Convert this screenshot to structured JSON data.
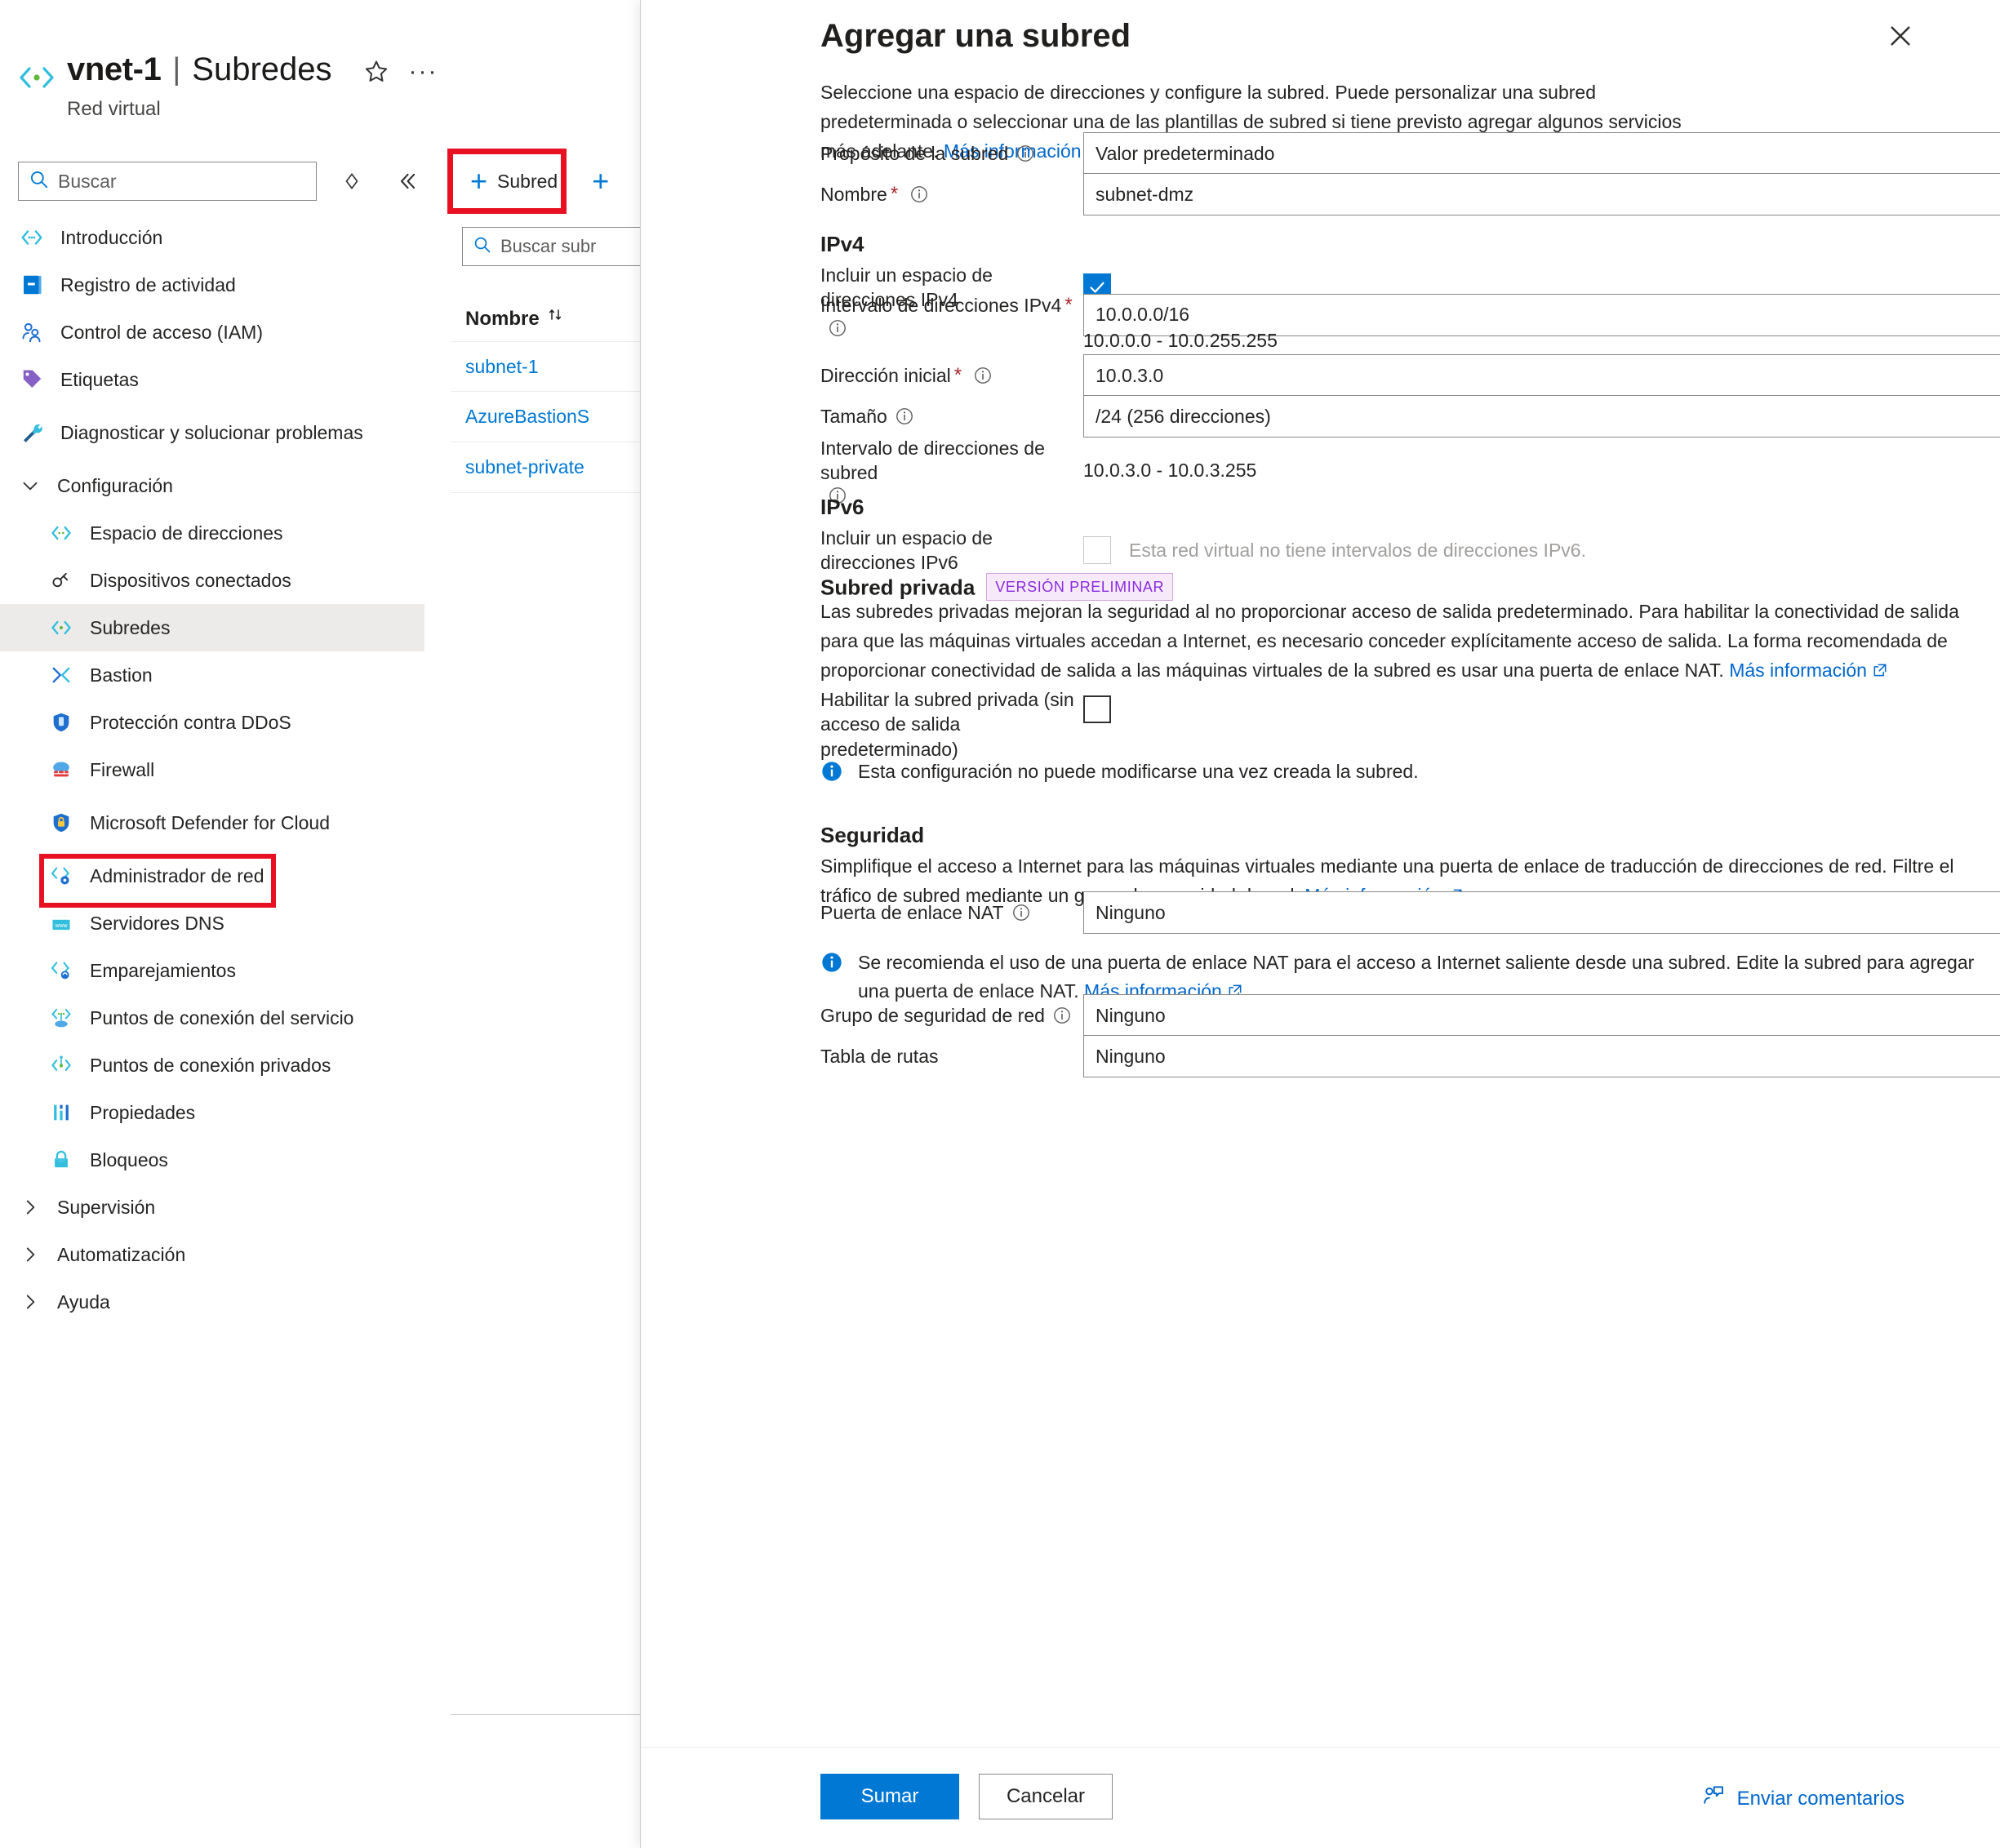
{
  "resource": {
    "name": "vnet-1",
    "separator": "|",
    "section": "Subredes",
    "type": "Red virtual",
    "icon": "vnet-icon"
  },
  "left_search": {
    "placeholder": "Buscar"
  },
  "sidebar": {
    "items": [
      {
        "label": "Introducción",
        "icon": "vnet-icon",
        "level": "top"
      },
      {
        "label": "Registro de actividad",
        "icon": "activity-log-icon",
        "level": "top"
      },
      {
        "label": "Control de acceso (IAM)",
        "icon": "iam-icon",
        "level": "top"
      },
      {
        "label": "Etiquetas",
        "icon": "tag-icon",
        "level": "top"
      },
      {
        "label": "Diagnosticar y solucionar problemas",
        "icon": "troubleshoot-icon",
        "level": "top"
      },
      {
        "label": "Configuración",
        "icon": "chevron-down-icon",
        "level": "group"
      },
      {
        "label": "Espacio de direcciones",
        "icon": "address-space-icon",
        "level": "child"
      },
      {
        "label": "Dispositivos conectados",
        "icon": "connected-devices-icon",
        "level": "child"
      },
      {
        "label": "Subredes",
        "icon": "subnet-icon",
        "level": "child",
        "selected": true
      },
      {
        "label": "Bastion",
        "icon": "bastion-icon",
        "level": "child"
      },
      {
        "label": "Protección contra DDoS",
        "icon": "ddos-icon",
        "level": "child"
      },
      {
        "label": "Firewall",
        "icon": "firewall-icon",
        "level": "child"
      },
      {
        "label": "Microsoft Defender for Cloud",
        "icon": "defender-icon",
        "level": "child"
      },
      {
        "label": "Administrador de red",
        "icon": "network-manager-icon",
        "level": "child"
      },
      {
        "label": "Servidores DNS",
        "icon": "dns-icon",
        "level": "child"
      },
      {
        "label": "Emparejamientos",
        "icon": "peering-icon",
        "level": "child"
      },
      {
        "label": "Puntos de conexión del servicio",
        "icon": "service-endpoint-icon",
        "level": "child"
      },
      {
        "label": "Puntos de conexión privados",
        "icon": "private-endpoint-icon",
        "level": "child"
      },
      {
        "label": "Propiedades",
        "icon": "properties-icon",
        "level": "child"
      },
      {
        "label": "Bloqueos",
        "icon": "lock-icon",
        "level": "child"
      },
      {
        "label": "Supervisión",
        "icon": "chevron-right-icon",
        "level": "group"
      },
      {
        "label": "Automatización",
        "icon": "chevron-right-icon",
        "level": "group"
      },
      {
        "label": "Ayuda",
        "icon": "chevron-right-icon",
        "level": "group"
      }
    ]
  },
  "list_pane": {
    "add_subnet_label": "Subred",
    "search_placeholder": "Buscar subr",
    "column_header": "Nombre",
    "rows": [
      {
        "name": "subnet-1"
      },
      {
        "name": "AzureBastionS"
      },
      {
        "name": "subnet-private"
      }
    ]
  },
  "panel": {
    "title": "Agregar una subred",
    "description_part1": "Seleccione una espacio de direcciones y configure la subred. Puede personalizar una subred predeterminada o seleccionar una de las plantillas de subred si tiene previsto agregar algunos servicios más adelante. ",
    "learn_more": "Más información",
    "fields": {
      "purpose_label": "Propósito de la subred",
      "purpose_value": "Valor predeterminado",
      "name_label": "Nombre",
      "name_value": "subnet-dmz",
      "ipv4_heading": "IPv4",
      "include_ipv4_label": "Incluir un espacio de direcciones IPv4",
      "ipv4_range_label": "Intervalo de direcciones IPv4",
      "ipv4_range_value": "10.0.0.0/16",
      "ipv4_range_hint": "10.0.0.0 - 10.0.255.255",
      "start_address_label": "Dirección inicial",
      "start_address_value": "10.0.3.0",
      "size_label": "Tamaño",
      "size_value": "/24 (256 direcciones)",
      "subnet_range_label": "Intervalo de direcciones de subred",
      "subnet_range_value": "10.0.3.0 - 10.0.3.255",
      "ipv6_heading": "IPv6",
      "include_ipv6_label": "Incluir un espacio de direcciones IPv6",
      "ipv6_disabled_text": "Esta red virtual no tiene intervalos de direcciones IPv6."
    },
    "private_subnet": {
      "heading": "Subred privada",
      "badge": "VERSIÓN PRELIMINAR",
      "paragraph": "Las subredes privadas mejoran la seguridad al no proporcionar acceso de salida predeterminado. Para habilitar la conectividad de salida para que las máquinas virtuales accedan a Internet, es necesario conceder explícitamente acceso de salida. La forma recomendada de proporcionar conectividad de salida a las máquinas virtuales de la subred es usar una puerta de enlace NAT. ",
      "learn_more": "Más información",
      "enable_label": "Habilitar la subred privada (sin acceso de salida predeterminado)",
      "info_note": "Esta configuración no puede modificarse una vez creada la subred."
    },
    "security": {
      "heading": "Seguridad",
      "paragraph": "Simplifique el acceso a Internet para las máquinas virtuales mediante una puerta de enlace de traducción de direcciones de red. Filtre el tráfico de subred mediante un grupo de seguridad de red. ",
      "learn_more": "Más información",
      "nat_label": "Puerta de enlace NAT",
      "nat_value": "Ninguno",
      "nat_info_note": "Se recomienda el uso de una puerta de enlace NAT para el acceso a Internet saliente desde una subred. Edite la subred para agregar una puerta de enlace NAT. ",
      "nat_info_learn_more": "Más información",
      "nsg_label": "Grupo de seguridad de red",
      "nsg_value": "Ninguno",
      "route_table_label": "Tabla de rutas",
      "route_table_value": "Ninguno"
    },
    "footer": {
      "submit_label": "Sumar",
      "cancel_label": "Cancelar",
      "feedback_label": "Enviar comentarios"
    }
  },
  "colors": {
    "accent": "#0078d4",
    "link": "#0066cc",
    "highlight_outline": "#e81123",
    "required_asterisk": "#a4262c",
    "preview_badge_text": "#8a2be2",
    "preview_badge_bg": "#f6eafa"
  }
}
